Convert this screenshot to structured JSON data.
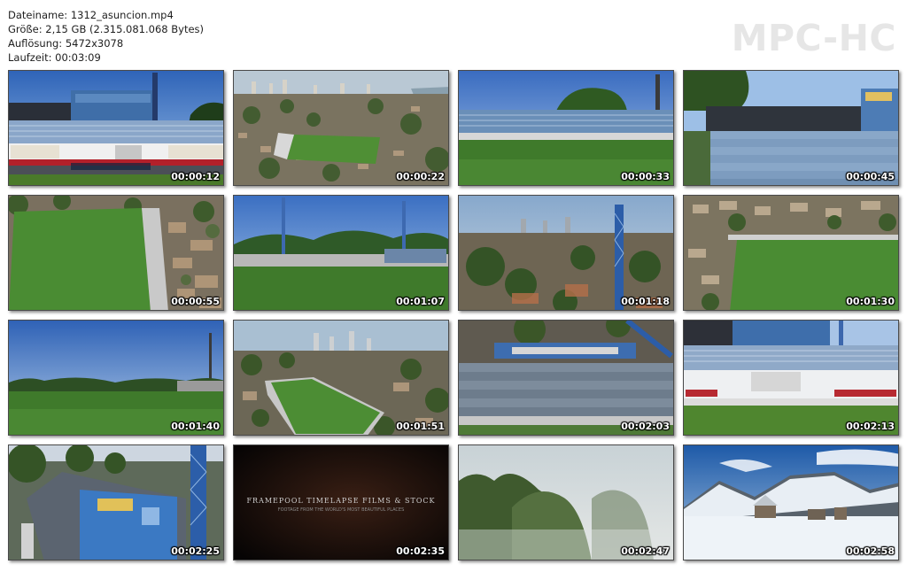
{
  "file_info": {
    "filename_line": "Dateiname: 1312_asuncion.mp4",
    "size_line": "Größe: 2,15 GB (2.315.081.068 Bytes)",
    "resolution_line": "Auflösung: 5472x3078",
    "duration_line": "Laufzeit: 00:03:09"
  },
  "logo": {
    "text": "MPC-HC",
    "color": "#e6e6e6"
  },
  "thumbnails": [
    {
      "timestamp": "00:00:12",
      "scene": "stand-front"
    },
    {
      "timestamp": "00:00:22",
      "scene": "aerial-city"
    },
    {
      "timestamp": "00:00:33",
      "scene": "pitch-stand"
    },
    {
      "timestamp": "00:00:45",
      "scene": "terraces"
    },
    {
      "timestamp": "00:00:55",
      "scene": "aerial-pitch-top"
    },
    {
      "timestamp": "00:01:07",
      "scene": "pitch-floodlights"
    },
    {
      "timestamp": "00:01:18",
      "scene": "aerial-tower"
    },
    {
      "timestamp": "00:01:30",
      "scene": "aerial-pitch-corner"
    },
    {
      "timestamp": "00:01:40",
      "scene": "pitch-low"
    },
    {
      "timestamp": "00:01:51",
      "scene": "aerial-city-2"
    },
    {
      "timestamp": "00:02:03",
      "scene": "stand-aerial-close"
    },
    {
      "timestamp": "00:02:13",
      "scene": "stand-front-2"
    },
    {
      "timestamp": "00:02:25",
      "scene": "stand-building"
    },
    {
      "timestamp": "00:02:35",
      "scene": "title-card",
      "caption": "FRAMEPOOL TIMELAPSE FILMS & STOCK",
      "caption2": "FOOTAGE FROM THE WORLD'S MOST BEAUTIFUL PLACES"
    },
    {
      "timestamp": "00:02:47",
      "scene": "mountains-mist"
    },
    {
      "timestamp": "00:02:58",
      "scene": "snow-mountain"
    }
  ]
}
